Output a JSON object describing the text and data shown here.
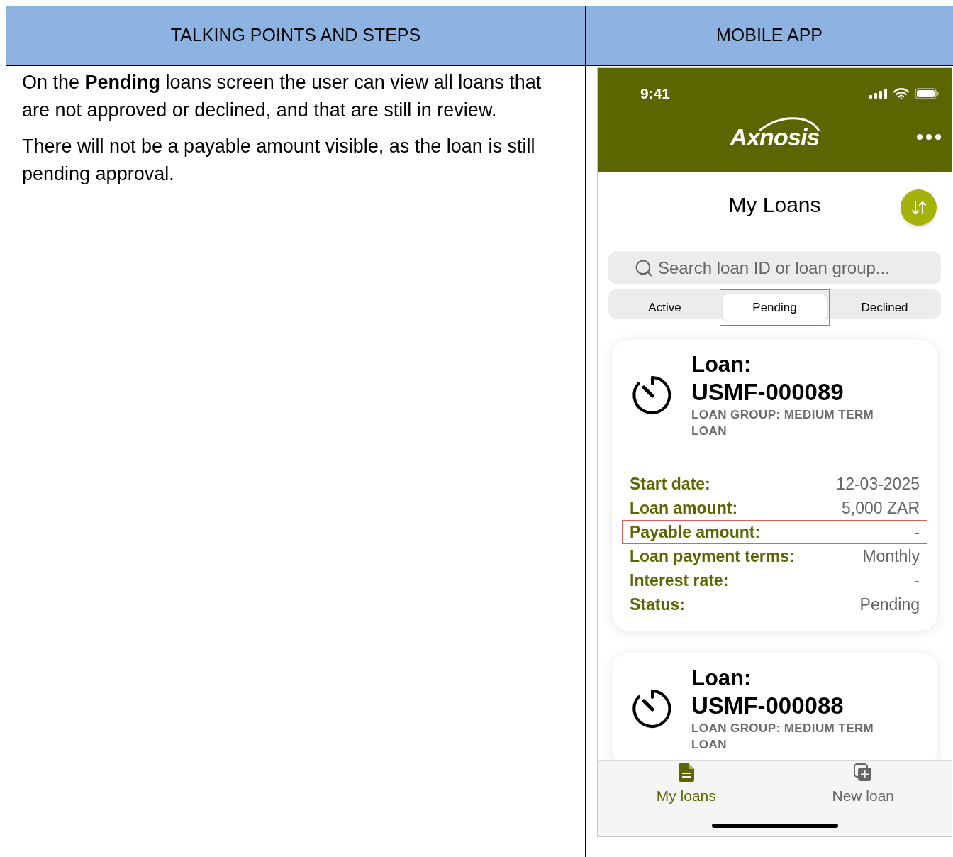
{
  "table": {
    "columns": [
      "TALKING POINTS AND STEPS",
      "MOBILE APP"
    ],
    "notes": [
      "On the **Pending** loans screen the user can view all loans that are not approved or declined, and that are still in review.",
      "There will not be a payable amount visible, as the loan is still pending approval."
    ]
  },
  "phone": {
    "status_bar": {
      "time": "9:41"
    },
    "logo": "Axnosis",
    "title": "My Loans",
    "search": {
      "placeholder": "Search loan ID or loan group..."
    },
    "tabs": [
      {
        "label": "Active",
        "selected": false,
        "highlighted": false
      },
      {
        "label": "Pending",
        "selected": true,
        "highlighted": true
      },
      {
        "label": "Declined",
        "selected": false,
        "highlighted": false
      }
    ],
    "loans": [
      {
        "title": "Loan:",
        "id": "USMF-000089",
        "group": "LOAN GROUP: MEDIUM TERM LOAN",
        "fields": [
          {
            "label": "Start date:",
            "value": "12-03-2025",
            "highlighted": false
          },
          {
            "label": "Loan amount:",
            "value": "5,000 ZAR",
            "highlighted": false
          },
          {
            "label": "Payable amount:",
            "value": "-",
            "highlighted": true
          },
          {
            "label": "Loan payment terms:",
            "value": "Monthly",
            "highlighted": false
          },
          {
            "label": "Interest rate:",
            "value": "-",
            "highlighted": false
          },
          {
            "label": "Status:",
            "value": "Pending",
            "highlighted": false
          }
        ]
      },
      {
        "title": "Loan:",
        "id": "USMF-000088",
        "group": "LOAN GROUP: MEDIUM TERM LOAN"
      }
    ],
    "nav": [
      {
        "label": "My loans",
        "kind": "list",
        "selected": true
      },
      {
        "label": "New loan",
        "kind": "add",
        "selected": false
      }
    ]
  }
}
